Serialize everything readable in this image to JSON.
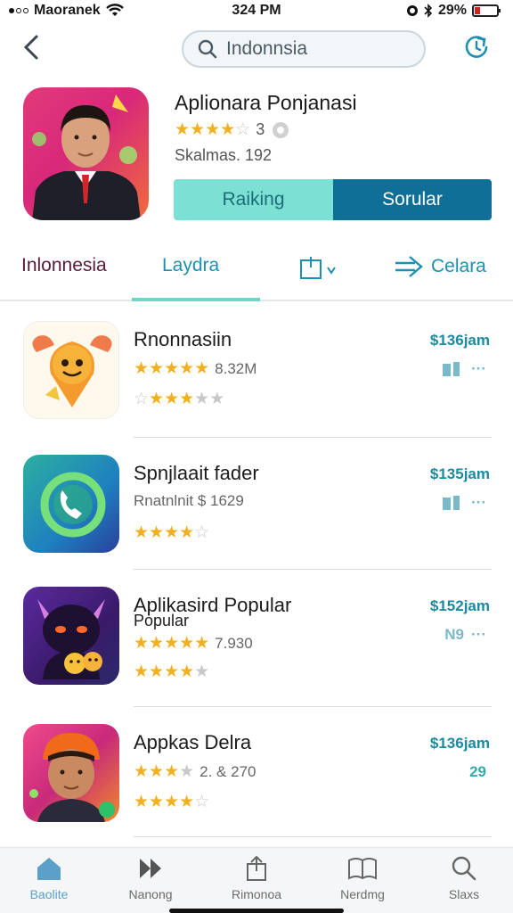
{
  "status_bar": {
    "carrier": "Maoranek",
    "time": "324 PM",
    "battery": "29%"
  },
  "search": {
    "value": "Indonnsia"
  },
  "featured": {
    "title": "Aplionara Ponjanasi",
    "rating_count": "3",
    "subtitle": "Skalmas. 192",
    "btn_ranking": "Raiking",
    "btn_popular": "Sorular"
  },
  "tabs": [
    {
      "label": "Inlonnesia"
    },
    {
      "label": "Laydra"
    },
    {
      "label": ""
    },
    {
      "label": "Celara"
    }
  ],
  "apps": [
    {
      "name": "Rnonnasiin",
      "name2": "",
      "meta": "8.32M",
      "price": "$136jam",
      "action": ""
    },
    {
      "name": "Spnjlaait fader",
      "name2": "",
      "meta": "Rnatnlnit $ 1629",
      "price": "$135jam",
      "action": ""
    },
    {
      "name": "Aplikasird Popular",
      "name2": "Popular",
      "meta": "7.930",
      "price": "$152jam",
      "action": "N9"
    },
    {
      "name": "Appkas Delra",
      "name2": "",
      "meta": "2.  & 270",
      "price": "$136jam",
      "action": "29"
    }
  ],
  "bottom_tabs": [
    {
      "label": "Baolite",
      "icon": "home-icon"
    },
    {
      "label": "Nanong",
      "icon": "fast-forward-icon"
    },
    {
      "label": "Rimonoa",
      "icon": "share-icon"
    },
    {
      "label": "Nerdmg",
      "icon": "book-icon"
    },
    {
      "label": "Slaxs",
      "icon": "search-icon"
    }
  ],
  "colors": {
    "accent_teal": "#7de0d4",
    "accent_blue": "#0f6f96",
    "star": "#f2b01e"
  }
}
